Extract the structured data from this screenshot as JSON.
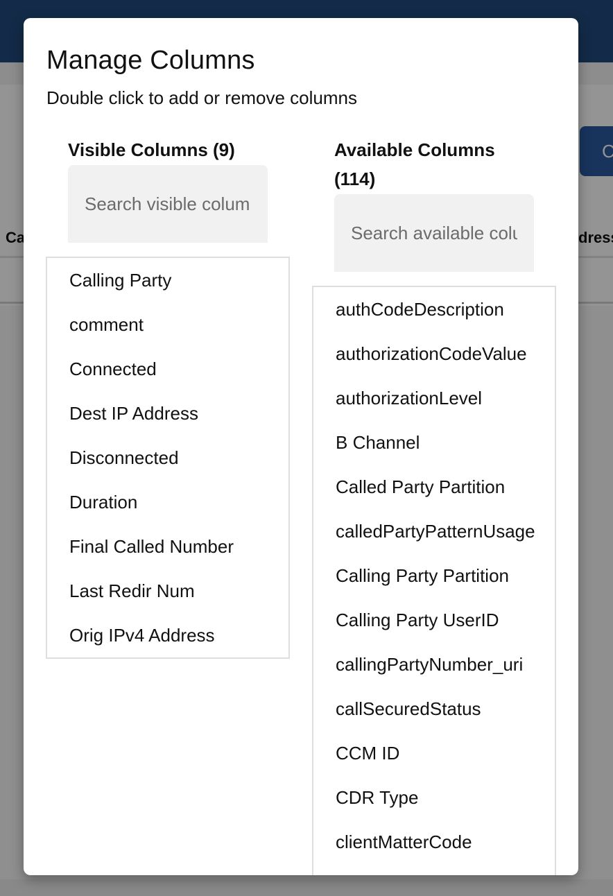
{
  "background": {
    "header_color": "#224a7c",
    "action_button_label": "C",
    "table_header_left": "Ca",
    "table_header_right": "dress"
  },
  "modal": {
    "title": "Manage Columns",
    "subtitle": "Double click to add or remove columns",
    "visible": {
      "heading": "Visible Columns (9)",
      "search_placeholder": "Search visible columns",
      "search_value": "",
      "items": [
        "Calling Party",
        "comment",
        "Connected",
        "Dest IP Address",
        "Disconnected",
        "Duration",
        "Final Called Number",
        "Last Redir Num",
        "Orig IPv4 Address"
      ]
    },
    "available": {
      "heading_line1": "Available Columns",
      "heading_line2": "(114)",
      "search_placeholder": "Search available columns",
      "search_value": "",
      "items": [
        "authCodeDescription",
        "authorizationCodeValue",
        "authorizationLevel",
        "B Channel",
        "Called Party Partition",
        "calledPartyPatternUsage",
        "Calling Party Partition",
        "Calling Party UserID",
        "callingPartyNumber_uri",
        "callSecuredStatus",
        "CCM ID",
        "CDR Type",
        "clientMatterCode"
      ]
    }
  }
}
